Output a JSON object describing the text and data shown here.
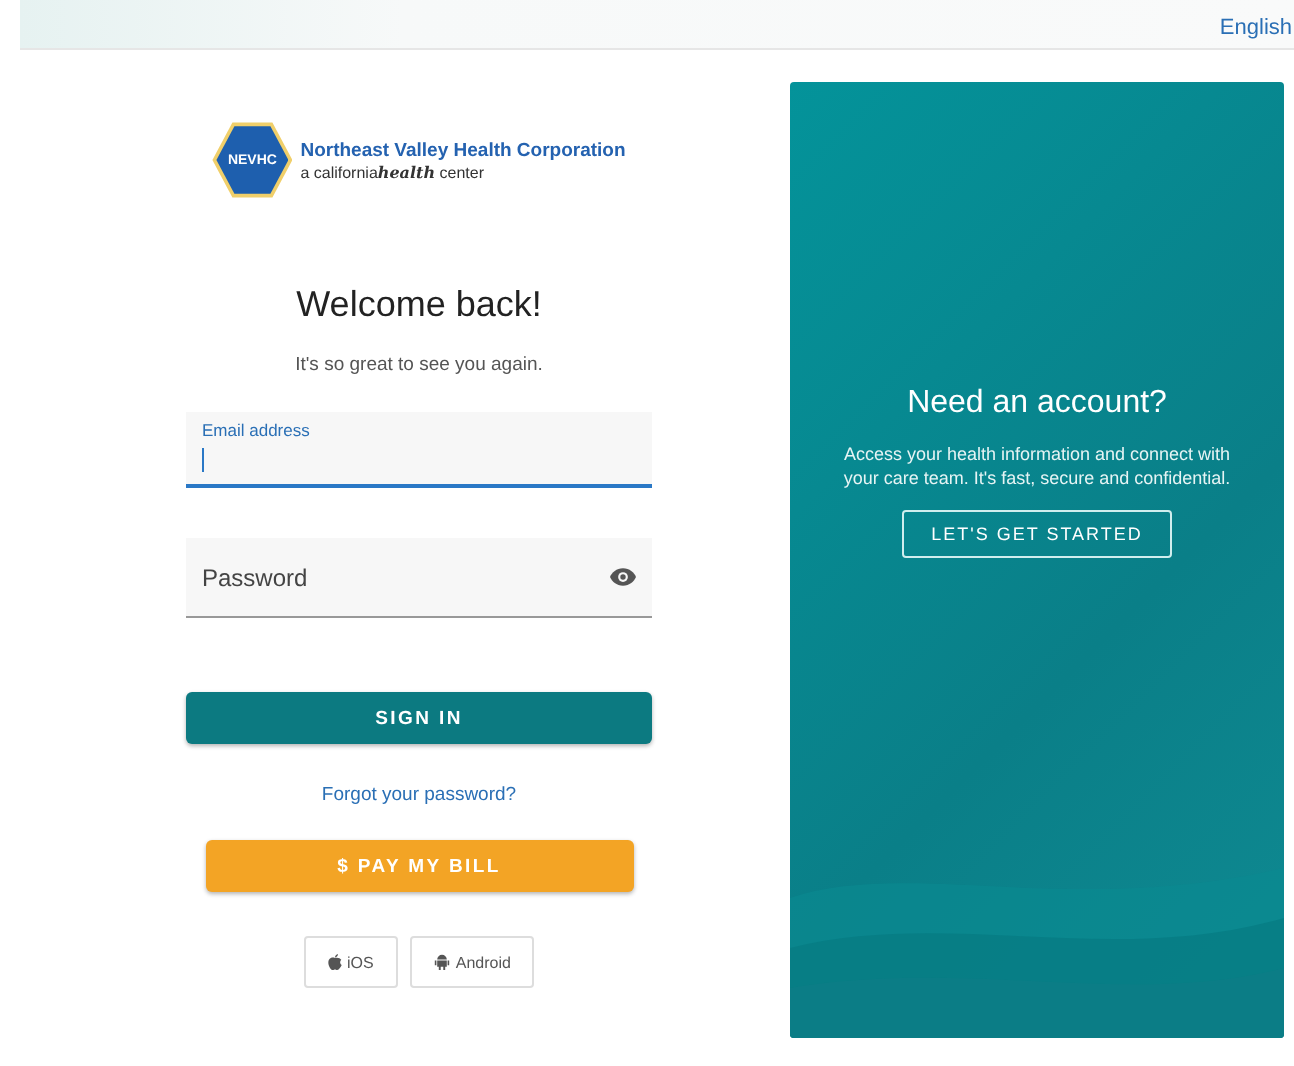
{
  "top_bar": {
    "language": "English"
  },
  "logo": {
    "badge": "NEVHC",
    "name": "Northeast Valley Health Corporation",
    "tagline": {
      "before": "a california",
      "brand": "health",
      "after": " center"
    }
  },
  "login": {
    "title": "Welcome back!",
    "subtitle": "It's so great to see you again.",
    "email": {
      "label": "Email address",
      "focused": true
    },
    "password": {
      "placeholder": "Password"
    },
    "sign_in": "SIGN IN",
    "forgot": "Forgot your password?",
    "pay": "$ PAY MY BILL",
    "apps": [
      {
        "kind": "apple",
        "label": "iOS"
      },
      {
        "kind": "android",
        "label": "Android"
      }
    ]
  },
  "signup": {
    "title": "Need an account?",
    "text": "Access your health information and connect with your care team. It's fast, secure and confidential.",
    "button": "LET'S GET STARTED"
  }
}
